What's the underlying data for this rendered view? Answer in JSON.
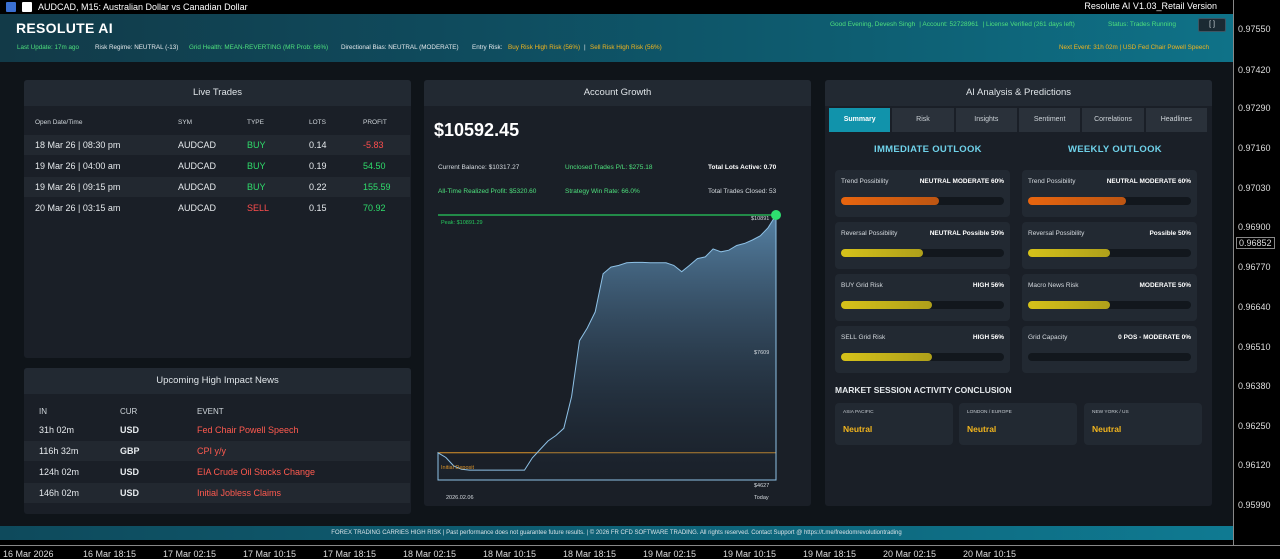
{
  "window": {
    "title": "AUDCAD, M15:  Australian Dollar vs Canadian Dollar",
    "version": "Resolute AI V1.03_Retail Version"
  },
  "header": {
    "brand": "RESOLUTE AI",
    "greeting": "Good Evening, Devesh Singh",
    "account": "Account: 52728961",
    "license": "License Verified (261 days left)",
    "status": "Status: Trades Running",
    "button": "[ ]"
  },
  "strip": {
    "last_update": "Last Update: 17m ago",
    "risk_regime": "Risk Regime: NEUTRAL (-13)",
    "grid_health": "Grid Health: MEAN-REVERTING (MR Prob: 66%)",
    "directional_bias": "Directional Bias: NEUTRAL (MODERATE)",
    "entry_risk_label": "Entry Risk:",
    "entry_risk_buy": "Buy Risk High Risk (56%)",
    "entry_risk_sell": "Sell Risk High Risk (56%)",
    "next_event": "Next Event: 31h 02m  |  USD Fed Chair Powell Speech"
  },
  "live_trades": {
    "title": "Live Trades",
    "headers": [
      "Open Date/Time",
      "SYM",
      "TYPE",
      "LOTS",
      "PROFIT"
    ],
    "rows": [
      {
        "time": "18 Mar 26  |  08:30 pm",
        "sym": "AUDCAD",
        "type": "BUY",
        "lots": "0.14",
        "profit": "-5.83"
      },
      {
        "time": "19 Mar 26  |  04:00 am",
        "sym": "AUDCAD",
        "type": "BUY",
        "lots": "0.19",
        "profit": "54.50"
      },
      {
        "time": "19 Mar 26  |  09:15 pm",
        "sym": "AUDCAD",
        "type": "BUY",
        "lots": "0.22",
        "profit": "155.59"
      },
      {
        "time": "20 Mar 26  |  03:15 am",
        "sym": "AUDCAD",
        "type": "SELL",
        "lots": "0.15",
        "profit": "70.92"
      }
    ]
  },
  "news": {
    "title": "Upcoming High Impact News",
    "headers": [
      "IN",
      "CUR",
      "EVENT"
    ],
    "rows": [
      {
        "in": "31h 02m",
        "cur": "USD",
        "event": "Fed Chair Powell Speech"
      },
      {
        "in": "116h 32m",
        "cur": "GBP",
        "event": "CPI y/y"
      },
      {
        "in": "124h 02m",
        "cur": "USD",
        "event": "EIA Crude Oil Stocks Change"
      },
      {
        "in": "146h 02m",
        "cur": "USD",
        "event": "Initial Jobless Claims"
      }
    ]
  },
  "growth": {
    "title": "Account Growth",
    "equity": "$10592.45",
    "current_balance": "Current Balance: $10317.27",
    "unclosed_pl": "Unclosed Trades P/L: $275.18",
    "lots_active": "Total Lots Active: 0.70",
    "realized_profit": "All-Time Realized Profit: $5320.60",
    "win_rate": "Strategy Win Rate: 66.0%",
    "trades_closed": "Total Trades Closed: 53",
    "peak_label": "Peak: $10891.29",
    "initial_label": "Initial Deposit",
    "label_top": "$10891",
    "label_mid": "$7609",
    "label_bottom": "$4627",
    "x_start": "2026.02.06",
    "x_end": "Today"
  },
  "chart_data": {
    "type": "area",
    "title": "Account Growth",
    "x_range": [
      "2026.02.06",
      "Today"
    ],
    "ylim": [
      4627,
      10891
    ],
    "peak": 10891.29,
    "initial_deposit": 5270,
    "values": [
      5270,
      5160,
      4960,
      4880,
      4860,
      4860,
      4860,
      4860,
      4860,
      4860,
      4860,
      4860,
      5150,
      5350,
      5550,
      5680,
      5850,
      6600,
      7920,
      8220,
      8600,
      9500,
      9660,
      9700,
      9760,
      9770,
      9770,
      9760,
      9760,
      9760,
      9700,
      9550,
      9700,
      9860,
      9900,
      10090,
      10020,
      10060,
      10170,
      10220,
      10300,
      10400,
      10590,
      10891
    ]
  },
  "ai": {
    "title": "AI Analysis & Predictions",
    "tabs": [
      "Summary",
      "Risk",
      "Insights",
      "Sentiment",
      "Correlations",
      "Headlines"
    ],
    "immediate_title": "IMMEDIATE OUTLOOK",
    "weekly_title": "WEEKLY OUTLOOK",
    "immediate": [
      {
        "label": "Trend Possibility",
        "value": "NEUTRAL MODERATE 60%",
        "level": 0.6,
        "color": "#e8650f"
      },
      {
        "label": "Reversal Possibility",
        "value": "NEUTRAL Possible 50%",
        "level": 0.5,
        "color": "#d6c21a"
      },
      {
        "label": "BUY Grid Risk",
        "value": "HIGH 56%",
        "level": 0.56,
        "color": "#d6c21a"
      },
      {
        "label": "SELL Grid Risk",
        "value": "HIGH 56%",
        "level": 0.56,
        "color": "#d6c21a"
      }
    ],
    "weekly": [
      {
        "label": "Trend Possibility",
        "value": "NEUTRAL MODERATE 60%",
        "level": 0.6,
        "color": "#e8650f"
      },
      {
        "label": "Reversal Possibility",
        "value": "Possible 50%",
        "level": 0.5,
        "color": "#d6c21a"
      },
      {
        "label": "Macro News Risk",
        "value": "MODERATE 50%",
        "level": 0.5,
        "color": "#d6c21a"
      },
      {
        "label": "Grid Capacity",
        "value": "0 POS - MODERATE 0%",
        "level": 0,
        "color": "#d6c21a"
      }
    ],
    "market_title": "MARKET SESSION ACTIVITY CONCLUSION",
    "sessions": [
      {
        "label": "ASIA PACIFIC",
        "value": "Neutral"
      },
      {
        "label": "LONDON / EUROPE",
        "value": "Neutral"
      },
      {
        "label": "NEW YORK / US",
        "value": "Neutral"
      }
    ]
  },
  "footer": "FOREX TRADING CARRIES HIGH RISK  |  Past performance does not guarantee future results.  |  © 2026 FR CFD SOFTWARE TRADING. All rights reserved. Contact Support @ https://t.me/freedomrevolutiontrading",
  "price_axis": [
    "0.97550",
    "0.97420",
    "0.97290",
    "0.97160",
    "0.97030",
    "0.96900",
    "0.96852",
    "0.96770",
    "0.96640",
    "0.96510",
    "0.96380",
    "0.96250",
    "0.96120",
    "0.95990"
  ],
  "time_axis": [
    "16 Mar 2026",
    "16 Mar 18:15",
    "17 Mar 02:15",
    "17 Mar 10:15",
    "17 Mar 18:15",
    "18 Mar 02:15",
    "18 Mar 10:15",
    "18 Mar 18:15",
    "19 Mar 02:15",
    "19 Mar 10:15",
    "19 Mar 18:15",
    "20 Mar 02:15",
    "20 Mar 10:15"
  ]
}
